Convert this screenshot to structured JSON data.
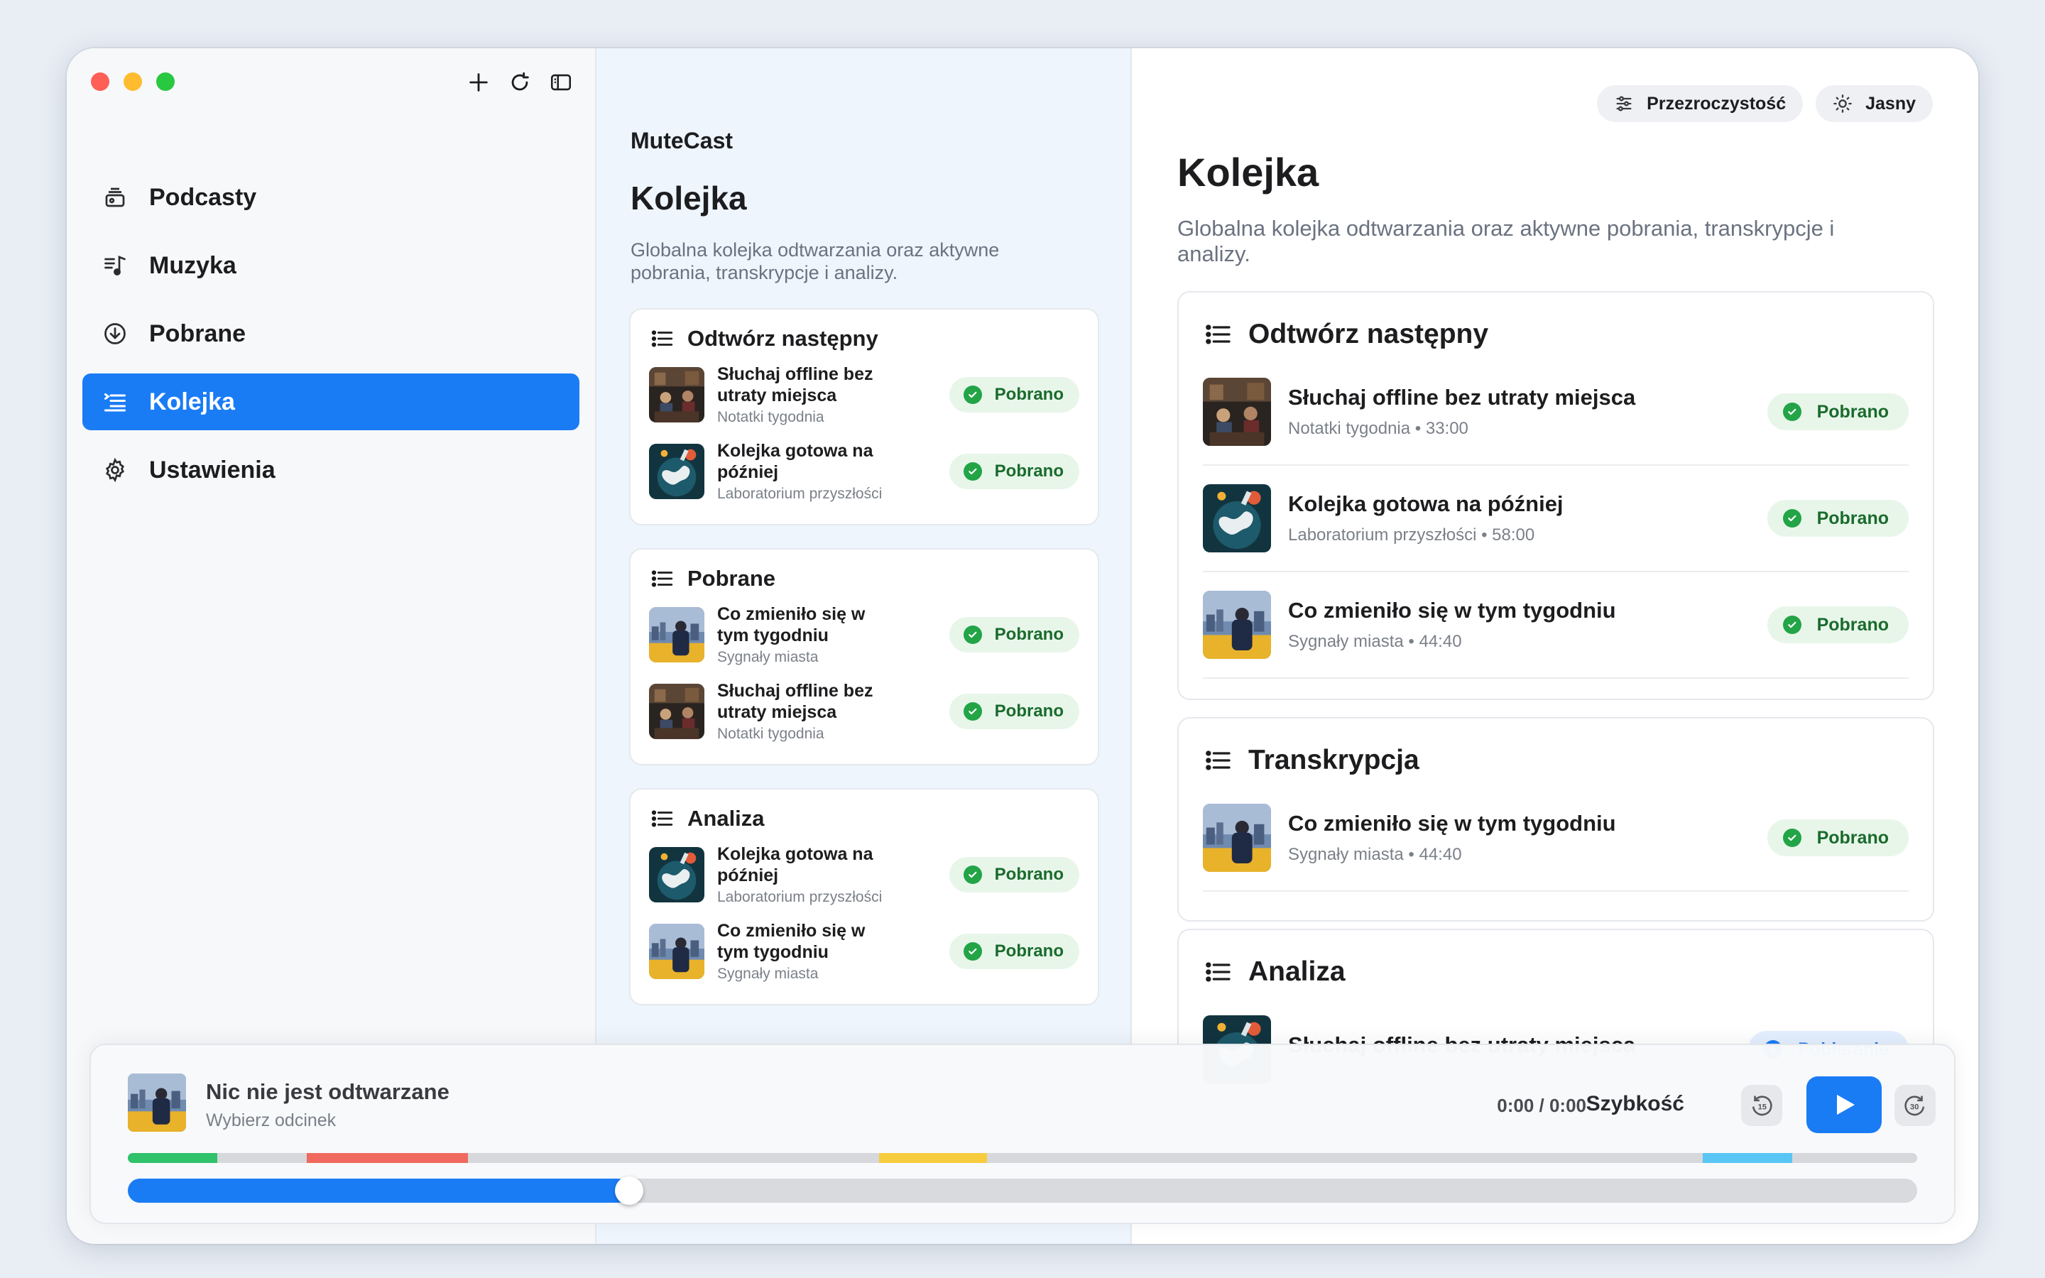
{
  "sidebar": {
    "items": [
      {
        "label": "Podcasty",
        "icon": "podcasts-stack-icon"
      },
      {
        "label": "Muzyka",
        "icon": "music-note-icon"
      },
      {
        "label": "Pobrane",
        "icon": "download-circle-icon"
      },
      {
        "label": "Kolejka",
        "icon": "queue-list-icon",
        "active": true
      },
      {
        "label": "Ustawienia",
        "icon": "gear-icon"
      }
    ]
  },
  "middle": {
    "app_name": "MuteCast",
    "title": "Kolejka",
    "description": "Globalna kolejka odtwarzania oraz aktywne pobrania, transkrypcje i analizy.",
    "sections": [
      {
        "title": "Odtwórz następny",
        "items": [
          {
            "title": "Słuchaj offline bez utraty miejsca",
            "subtitle": "Notatki tygodnia",
            "badge": "Pobrano",
            "thumb": "studio"
          },
          {
            "title": "Kolejka gotowa na później",
            "subtitle": "Laboratorium przyszłości",
            "badge": "Pobrano",
            "thumb": "globe"
          }
        ]
      },
      {
        "title": "Pobrane",
        "items": [
          {
            "title": "Co zmieniło się w tym tygodniu",
            "subtitle": "Sygnały miasta",
            "badge": "Pobrano",
            "thumb": "city"
          },
          {
            "title": "Słuchaj offline bez utraty miejsca",
            "subtitle": "Notatki tygodnia",
            "badge": "Pobrano",
            "thumb": "studio"
          }
        ]
      },
      {
        "title": "Analiza",
        "items": [
          {
            "title": "Kolejka gotowa na później",
            "subtitle": "Laboratorium przyszłości",
            "badge": "Pobrano",
            "thumb": "globe"
          },
          {
            "title": "Co zmieniło się w tym tygodniu",
            "subtitle": "Sygnały miasta",
            "badge": "Pobrano",
            "thumb": "city"
          }
        ]
      }
    ]
  },
  "right": {
    "pills": {
      "transparency": "Przezroczystość",
      "theme": "Jasny"
    },
    "title": "Kolejka",
    "description": "Globalna kolejka odtwarzania oraz aktywne pobrania, transkrypcje i analizy.",
    "sections": [
      {
        "title": "Odtwórz następny",
        "items": [
          {
            "title": "Słuchaj offline bez utraty miejsca",
            "subtitle": "Notatki tygodnia • 33:00",
            "badge": "Pobrano",
            "thumb": "studio"
          },
          {
            "title": "Kolejka gotowa na później",
            "subtitle": "Laboratorium przyszłości • 58:00",
            "badge": "Pobrano",
            "thumb": "globe"
          },
          {
            "title": "Co zmieniło się w tym tygodniu",
            "subtitle": "Sygnały miasta • 44:40",
            "badge": "Pobrano",
            "thumb": "city"
          }
        ]
      },
      {
        "title": "Transkrypcja",
        "items": [
          {
            "title": "Co zmieniło się w tym tygodniu",
            "subtitle": "Sygnały miasta • 44:40",
            "badge": "Pobrano",
            "thumb": "city"
          }
        ]
      },
      {
        "title": "Analiza",
        "items": [
          {
            "title": "Słuchaj offline bez utraty miejsca",
            "subtitle": "",
            "badge": "Pobieranie",
            "badge_style": "blue",
            "thumb": "globe"
          }
        ]
      }
    ]
  },
  "player": {
    "title": "Nic nie jest odtwarzane",
    "subtitle": "Wybierz odcinek",
    "time": "0:00 / 0:00",
    "speed_label": "Szybkość",
    "skip_back": "15",
    "skip_forward": "30",
    "progress_fraction": 0.28,
    "segments": [
      {
        "start": 0.0,
        "end": 0.05,
        "color": "#2fc26b"
      },
      {
        "start": 0.1,
        "end": 0.19,
        "color": "#f0695e"
      },
      {
        "start": 0.42,
        "end": 0.48,
        "color": "#f6cc3f"
      },
      {
        "start": 0.88,
        "end": 0.93,
        "color": "#58c5f5"
      }
    ]
  },
  "colors": {
    "accent": "#1a7cf5",
    "badge_green": "#22a447",
    "badge_bg": "#e8f6ea"
  }
}
